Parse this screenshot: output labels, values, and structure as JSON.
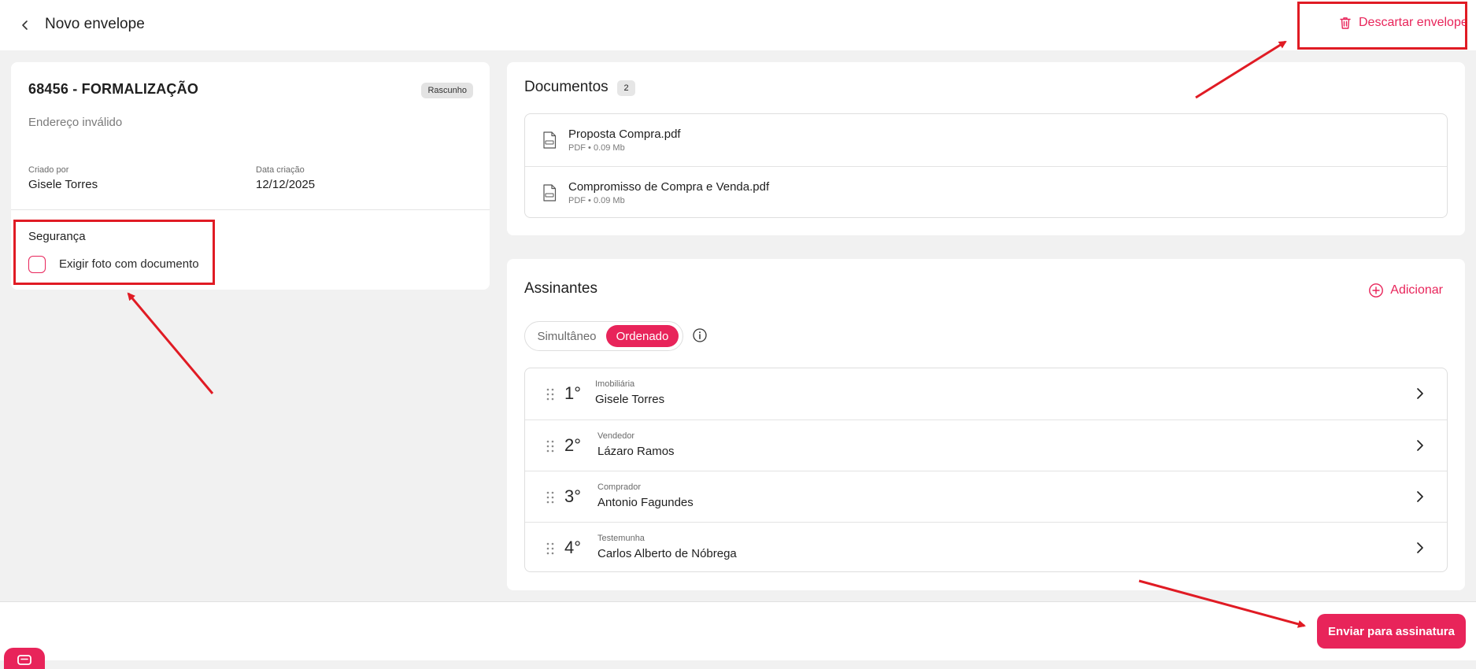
{
  "header": {
    "title": "Novo envelope",
    "discard_label": "Descartar envelope"
  },
  "envelope": {
    "title": "68456 - FORMALIZAÇÃO",
    "status": "Rascunho",
    "address": "Endereço inválido",
    "created_by_label": "Criado por",
    "created_by": "Gisele Torres",
    "created_date_label": "Data criação",
    "created_date": "12/12/2025"
  },
  "security": {
    "title": "Segurança",
    "photo_label": "Exigir foto com documento",
    "photo_checked": false
  },
  "documents": {
    "title": "Documentos",
    "count": "2",
    "items": [
      {
        "name": "Proposta Compra.pdf",
        "meta": "PDF • 0.09 Mb"
      },
      {
        "name": "Compromisso de Compra e Venda.pdf",
        "meta": "PDF • 0.09 Mb"
      }
    ]
  },
  "signers": {
    "title": "Assinantes",
    "add_label": "Adicionar",
    "mode_options": [
      "Simultâneo",
      "Ordenado"
    ],
    "mode_selected": "Ordenado",
    "items": [
      {
        "order": "1°",
        "role": "Imobiliária",
        "name": "Gisele Torres"
      },
      {
        "order": "2°",
        "role": "Vendedor",
        "name": "Lázaro Ramos"
      },
      {
        "order": "3°",
        "role": "Comprador",
        "name": "Antonio Fagundes"
      },
      {
        "order": "4°",
        "role": "Testemunha",
        "name": "Carlos Alberto de Nóbrega"
      }
    ]
  },
  "footer": {
    "submit_label": "Enviar para assinatura"
  },
  "colors": {
    "accent": "#e8245a",
    "annotation": "#e01b24",
    "background": "#f1f1f1"
  },
  "icons": [
    "chevron-left-icon",
    "trash-icon",
    "pdf-file-icon",
    "plus-circle-icon",
    "info-icon",
    "drag-handle-icon",
    "chevron-right-icon",
    "chat-icon"
  ]
}
